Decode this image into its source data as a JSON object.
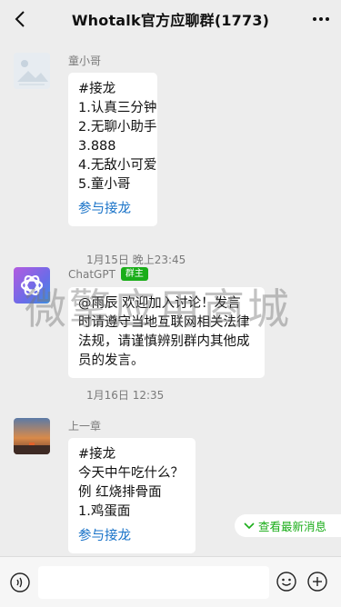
{
  "header": {
    "title": "Whotalk官方应聊群(1773)"
  },
  "messages": [
    {
      "sender": "童小哥",
      "lines": [
        "#接龙",
        "1.认真三分钟",
        "2.无聊小助手",
        "3.888",
        "4.无敌小可爱",
        "5.童小哥"
      ],
      "link": "参与接龙",
      "time": "1月15日 晚上23:45"
    },
    {
      "sender": "ChatGPT",
      "badge": "群主",
      "lines": [
        "@雨辰 欢迎加入讨论！发言",
        "时请遵守当地互联网相关法律",
        "法规，请谨慎辨别群内其他成",
        "员的发言。"
      ],
      "time": "1月16日 12:35"
    },
    {
      "sender": "上一章",
      "lines": [
        "#接龙",
        "今天中午吃什么？",
        "例 红烧排骨面",
        "1.鸡蛋面"
      ],
      "link": "参与接龙"
    }
  ],
  "watermark": "微擎应用商城",
  "new_messages_label": "查看最新消息",
  "input": {
    "value": ""
  },
  "colors": {
    "accent_green": "#1aad19",
    "link_blue": "#1a73c8",
    "background": "#ededed"
  }
}
